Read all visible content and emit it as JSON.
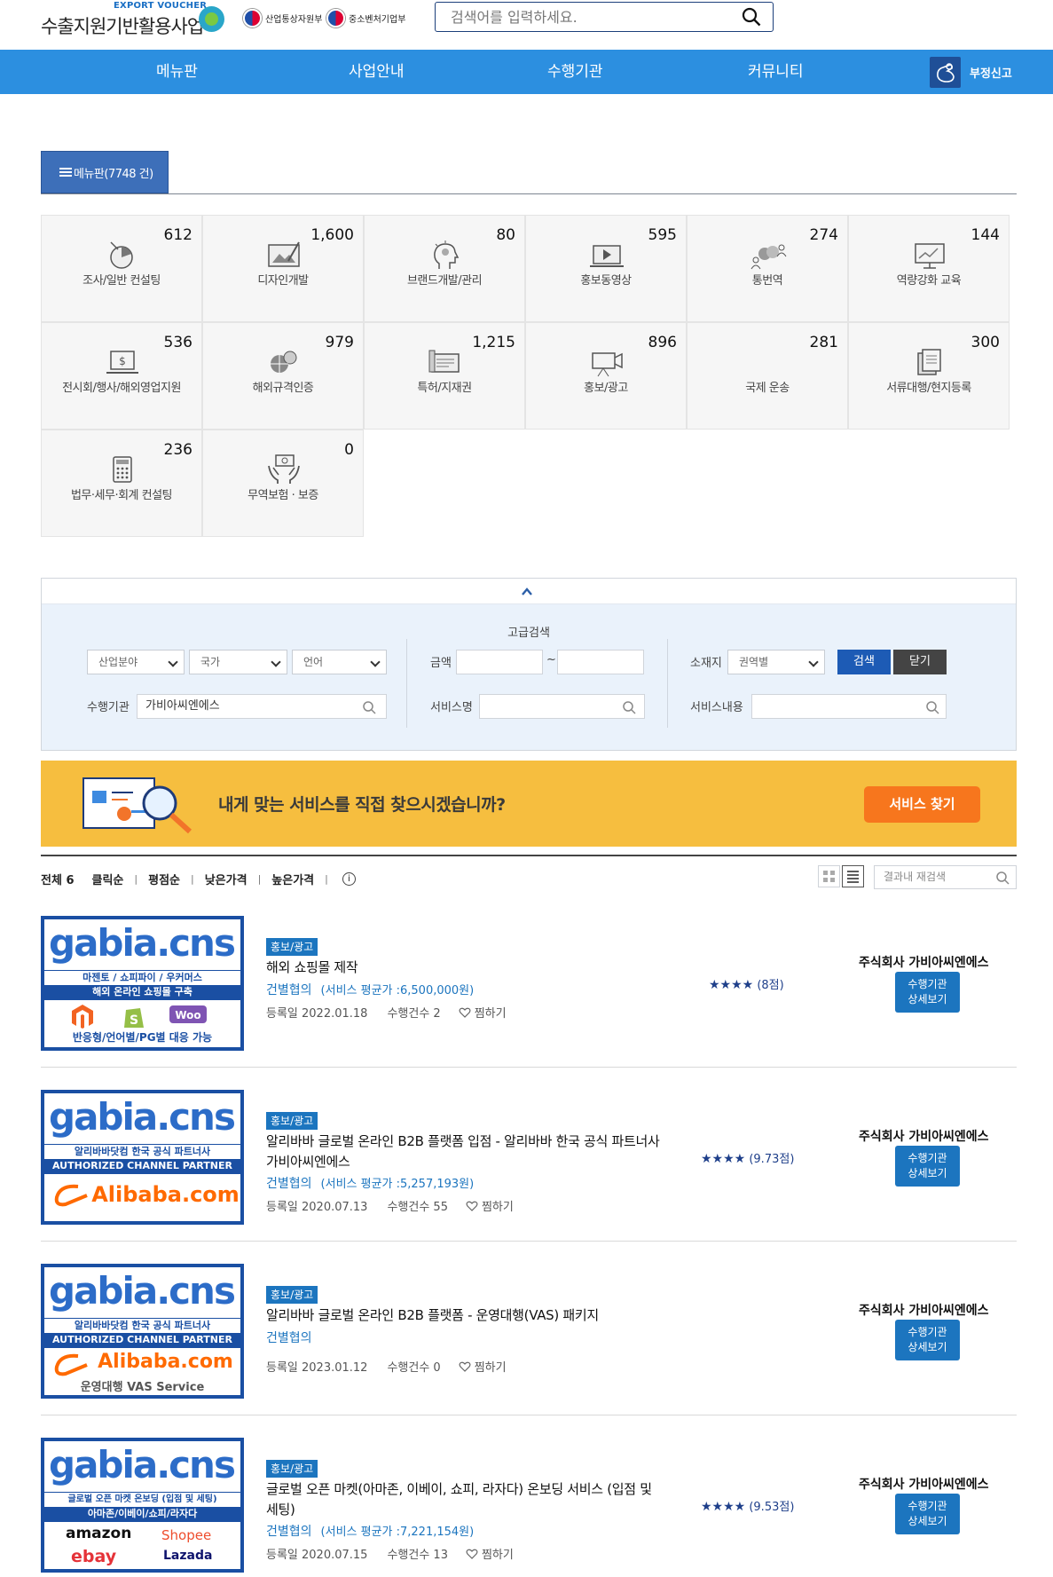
{
  "header": {
    "logo_sub": "EXPORT VOUCHER",
    "logo_main": "수출지원기반활용사업",
    "ministry1": "산업통상자원부",
    "ministry2": "중소벤처기업부",
    "search_placeholder": "검색어를 입력하세요."
  },
  "nav": {
    "items": [
      "메뉴판",
      "사업안내",
      "수행기관",
      "커뮤니티"
    ],
    "report": "부정신고"
  },
  "menu_tab": {
    "label": "메뉴판(7748 건)"
  },
  "categories": [
    {
      "label": "조사/일반 컨설팅",
      "count": "612",
      "icon": "chart-icon"
    },
    {
      "label": "디자인개발",
      "count": "1,600",
      "icon": "design-icon"
    },
    {
      "label": "브랜드개발/관리",
      "count": "80",
      "icon": "brand-head-icon"
    },
    {
      "label": "홍보동영상",
      "count": "595",
      "icon": "video-icon"
    },
    {
      "label": "통번역",
      "count": "274",
      "icon": "translate-icon"
    },
    {
      "label": "역량강화 교육",
      "count": "144",
      "icon": "education-icon"
    },
    {
      "label": "전시회/행사/해외영업지원",
      "count": "536",
      "icon": "exhibition-icon"
    },
    {
      "label": "해외규격인증",
      "count": "979",
      "icon": "certification-icon"
    },
    {
      "label": "특허/지재권",
      "count": "1,215",
      "icon": "patent-icon"
    },
    {
      "label": "홍보/광고",
      "count": "896",
      "icon": "camera-icon"
    },
    {
      "label": "국제 운송",
      "count": "281",
      "icon": "shipping-icon"
    },
    {
      "label": "서류대행/현지등록",
      "count": "300",
      "icon": "document-icon"
    },
    {
      "label": "법무·세무·회계 컨설팅",
      "count": "236",
      "icon": "calculator-icon"
    },
    {
      "label": "무역보험 · 보증",
      "count": "0",
      "icon": "insurance-icon"
    }
  ],
  "advanced": {
    "title": "고급검색",
    "industry": "산업분야",
    "country": "국가",
    "language": "언어",
    "amount_label": "금액",
    "tilde": "~",
    "location_label": "소재지",
    "location_value": "권역별",
    "search_btn": "검색",
    "close_btn": "닫기",
    "agency_label": "수행기관",
    "agency_value": "가비아씨엔에스",
    "service_name_label": "서비스명",
    "service_content_label": "서비스내용"
  },
  "banner": {
    "text": "내게 맞는 서비스를 직접 찾으시겠습니까?",
    "button": "서비스 찾기"
  },
  "sort": {
    "total": "전체 6",
    "options": [
      "클릭순",
      "평점순",
      "낮은가격",
      "높은가격"
    ],
    "info": "i",
    "result_search_placeholder": "결과내 재검색"
  },
  "results": [
    {
      "badge": "홍보/광고",
      "title": "해외 쇼핑몰 제작",
      "org": "건별협의",
      "price": "(서비스 평균가 :6,500,000원)",
      "reg": "등록일 2022.01.18",
      "count": "수행건수 2",
      "wish": "찜하기",
      "stars": "★★★★",
      "rating": "(8점)",
      "company": "주식회사 가비아씨엔에스",
      "detail1": "수행기관",
      "detail2": "상세보기",
      "thumb": {
        "brand": "gabia.cns",
        "strip1": "마젠토 / 쇼피파이 / 우커머스",
        "strip2": "해외 온라인 쇼핑몰 구축",
        "foot": "반응형/언어별/PG별 대응 가능",
        "logos": [
          "magento-logo",
          "shopify-logo",
          "woo-logo"
        ]
      }
    },
    {
      "badge": "홍보/광고",
      "title": "알리바바 글로벌 온라인 B2B 플랫폼 입점 - 알리바바 한국 공식 파트너사 가비아씨엔에스",
      "org": "건별협의",
      "price": "(서비스 평균가 :5,257,193원)",
      "reg": "등록일 2020.07.13",
      "count": "수행건수 55",
      "wish": "찜하기",
      "stars": "★★★★",
      "rating": "(9.73점)",
      "company": "주식회사 가비아씨엔에스",
      "detail1": "수행기관",
      "detail2": "상세보기",
      "thumb": {
        "brand": "gabia.cns",
        "strip1": "알리바바닷컴 한국 공식 파트너사",
        "strip2": "AUTHORIZED CHANNEL PARTNER",
        "foot": "Alibaba.com",
        "foot2": ""
      }
    },
    {
      "badge": "홍보/광고",
      "title": "알리바바 글로벌 온라인 B2B 플랫폼 - 운영대행(VAS) 패키지",
      "org": "건별협의",
      "price": "",
      "reg": "등록일 2023.01.12",
      "count": "수행건수 0",
      "wish": "찜하기",
      "stars": "",
      "rating": "",
      "company": "주식회사 가비아씨엔에스",
      "detail1": "수행기관",
      "detail2": "상세보기",
      "thumb": {
        "brand": "gabia.cns",
        "strip1": "알리바바닷컴 한국 공식 파트너사",
        "strip2": "AUTHORIZED CHANNEL PARTNER",
        "foot": "Alibaba.com",
        "foot2": "운영대행 VAS Service"
      }
    },
    {
      "badge": "홍보/광고",
      "title": "글로벌 오픈 마켓(아마존, 이베이, 쇼피, 라자다) 온보딩 서비스 (입점 및 세팅)",
      "org": "건별협의",
      "price": "(서비스 평균가 :7,221,154원)",
      "reg": "등록일 2020.07.15",
      "count": "수행건수 13",
      "wish": "찜하기",
      "stars": "★★★★",
      "rating": "(9.53점)",
      "company": "주식회사 가비아씨엔에스",
      "detail1": "수행기관",
      "detail2": "상세보기",
      "thumb": {
        "brand": "gabia.cns",
        "strip1": "글로벌 오픈 마켓 온보딩 (입점 및 세팅)",
        "strip2": "아마존/이베이/쇼피/라자다",
        "m1": "amazon",
        "m2": "Shopee",
        "m3": "ebay",
        "m4": "Lazada"
      }
    }
  ],
  "colors": {
    "nav": "#2c8fe0",
    "accent": "#1c75bf",
    "banner": "#f6be3f",
    "banner_btn": "#f7761d"
  }
}
